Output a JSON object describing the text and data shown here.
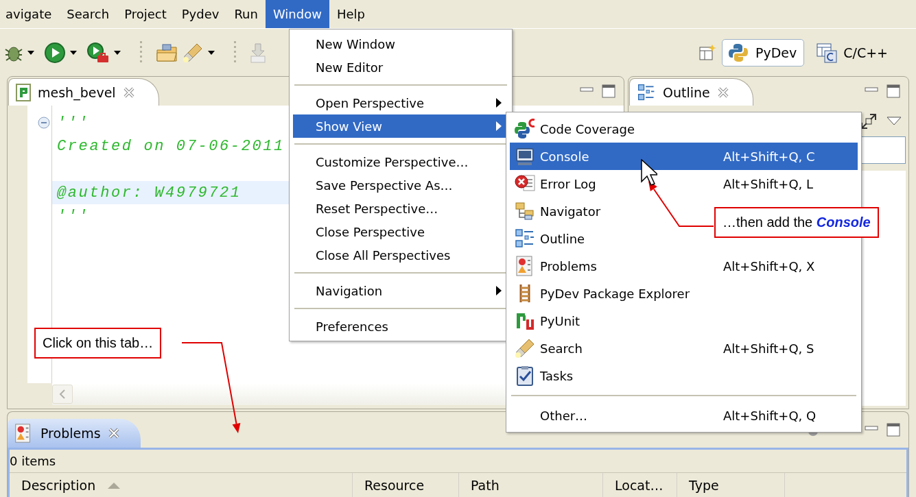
{
  "menubar": [
    {
      "label": "avigate",
      "selected": false
    },
    {
      "label": "Search",
      "selected": false
    },
    {
      "label": "Project",
      "selected": false
    },
    {
      "label": "Pydev",
      "selected": false
    },
    {
      "label": "Run",
      "selected": false
    },
    {
      "label": "Window",
      "selected": true
    },
    {
      "label": "Help",
      "selected": false
    }
  ],
  "perspectives": [
    {
      "label": "PyDev",
      "selected": true
    },
    {
      "label": "C/C++",
      "selected": false
    }
  ],
  "editor": {
    "tab": "mesh_bevel",
    "lines": [
      {
        "kind": "code",
        "text": "'''",
        "current": false,
        "expanded": true
      },
      {
        "kind": "code",
        "text": "Created on 07-06-2011",
        "current": false
      },
      {
        "kind": "blank",
        "current": false
      },
      {
        "kind": "code",
        "text": "@author: W4979721",
        "current": true
      },
      {
        "kind": "code",
        "text": "'''",
        "current": false
      }
    ]
  },
  "outline": {
    "tab": "Outline"
  },
  "problems": {
    "tab": "Problems",
    "summary": "0 items",
    "columns": [
      {
        "label": "Description",
        "sorted": true
      },
      {
        "label": "Resource",
        "sorted": false
      },
      {
        "label": "Path",
        "sorted": false
      },
      {
        "label": "Locat…",
        "sorted": false
      },
      {
        "label": "Type",
        "sorted": false
      }
    ]
  },
  "window_menu": {
    "items": [
      {
        "kind": "item",
        "label": "New Window",
        "selected": false
      },
      {
        "kind": "item",
        "label": "New Editor",
        "selected": false
      },
      {
        "kind": "separator"
      },
      {
        "kind": "submenu",
        "label": "Open Perspective",
        "selected": false
      },
      {
        "kind": "submenu",
        "label": "Show View",
        "selected": true
      },
      {
        "kind": "separator"
      },
      {
        "kind": "item",
        "label": "Customize Perspective…",
        "selected": false
      },
      {
        "kind": "item",
        "label": "Save Perspective As…",
        "selected": false
      },
      {
        "kind": "item",
        "label": "Reset Perspective…",
        "selected": false
      },
      {
        "kind": "item",
        "label": "Close Perspective",
        "selected": false
      },
      {
        "kind": "item",
        "label": "Close All Perspectives",
        "selected": false
      },
      {
        "kind": "separator"
      },
      {
        "kind": "submenu",
        "label": "Navigation",
        "selected": false
      },
      {
        "kind": "separator"
      },
      {
        "kind": "item",
        "label": "Preferences",
        "selected": false
      }
    ]
  },
  "show_view_menu": {
    "items": [
      {
        "kind": "item",
        "label": "Code Coverage",
        "selected": false
      },
      {
        "kind": "item",
        "label": "Console",
        "shortcut": "Alt+Shift+Q, C",
        "selected": true
      },
      {
        "kind": "item",
        "label": "Error Log",
        "shortcut": "Alt+Shift+Q, L",
        "selected": false
      },
      {
        "kind": "item",
        "label": "Navigator",
        "selected": false
      },
      {
        "kind": "item",
        "label": "Outline",
        "selected": false
      },
      {
        "kind": "item",
        "label": "Problems",
        "shortcut": "Alt+Shift+Q, X",
        "selected": false
      },
      {
        "kind": "item",
        "label": "PyDev Package Explorer",
        "selected": false
      },
      {
        "kind": "item",
        "label": "PyUnit",
        "selected": false
      },
      {
        "kind": "item",
        "label": "Search",
        "shortcut": "Alt+Shift+Q, S",
        "selected": false
      },
      {
        "kind": "item",
        "label": "Tasks",
        "selected": false
      },
      {
        "kind": "separator"
      },
      {
        "kind": "item",
        "label": "Other…",
        "shortcut": "Alt+Shift+Q, Q",
        "selected": false
      }
    ]
  },
  "callouts": [
    {
      "text": "Click on this tab…"
    },
    {
      "text": "…then add the **Console**"
    }
  ]
}
